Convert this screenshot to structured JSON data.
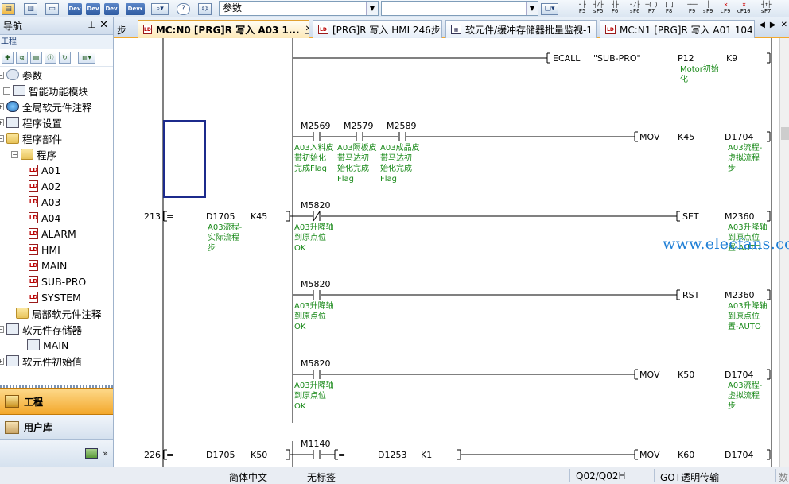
{
  "toolbar": {
    "combo_value": "参数",
    "fkeys": [
      {
        "glyph": "┤├",
        "label": "F5"
      },
      {
        "glyph": "┤/├",
        "label": "sF5"
      },
      {
        "glyph": "┤├",
        "label": "F6"
      },
      {
        "glyph": "┤/├",
        "label": "sF6"
      },
      {
        "glyph": "─( )",
        "label": "F7"
      },
      {
        "glyph": "[  ]",
        "label": "F8"
      },
      {
        "glyph": "───",
        "label": "F9"
      },
      {
        "glyph": "│",
        "label": "sF9"
      },
      {
        "glyph": "✕",
        "label": "cF9"
      },
      {
        "glyph": "✕",
        "label": "cF10"
      },
      {
        "glyph": "┤↑├",
        "label": "sF7"
      }
    ]
  },
  "nav": {
    "title": "导航",
    "subtitle": "工程",
    "tree": [
      {
        "label": "参数",
        "icon": "gear-icon"
      },
      {
        "label": "智能功能模块",
        "icon": "module-icon"
      },
      {
        "label": "全局软元件注释",
        "icon": "globe-icon"
      },
      {
        "label": "程序设置",
        "icon": "settings-icon"
      },
      {
        "label": "程序部件",
        "icon": "folder-icon"
      },
      {
        "label": "程序",
        "icon": "folder-icon"
      },
      {
        "label": "A01",
        "icon": "program-icon"
      },
      {
        "label": "A02",
        "icon": "program-icon"
      },
      {
        "label": "A03",
        "icon": "program-icon"
      },
      {
        "label": "A04",
        "icon": "program-icon"
      },
      {
        "label": "ALARM",
        "icon": "program-icon"
      },
      {
        "label": "HMI",
        "icon": "program-icon"
      },
      {
        "label": "MAIN",
        "icon": "program-icon"
      },
      {
        "label": "SUB-PRO",
        "icon": "program-icon"
      },
      {
        "label": "SYSTEM",
        "icon": "program-icon"
      },
      {
        "label": "局部软元件注释",
        "icon": "folder-icon"
      },
      {
        "label": "软元件存储器",
        "icon": "memory-icon"
      },
      {
        "label": "MAIN",
        "icon": "memory-icon"
      },
      {
        "label": "软元件初始值",
        "icon": "memory-icon"
      }
    ],
    "bottom_project": "工程",
    "bottom_library": "用户库"
  },
  "tabs": [
    {
      "label": "MC:N0 [PRG]R 写入 A03 1...",
      "active": true
    },
    {
      "label": "[PRG]R 写入 HMI 246步",
      "active": false
    },
    {
      "label": "软元件/缓冲存储器批量监视-1",
      "active": false
    },
    {
      "label": "MC:N1 [PRG]R 写入 A01 104",
      "active": false
    }
  ],
  "tab_left_partial": "步",
  "ladder": {
    "top": {
      "instr": "ECALL",
      "arg1": "\"SUB-PRO\"",
      "arg2": "P12",
      "arg3": "K9",
      "comment": [
        "Motor初始",
        "化"
      ]
    },
    "rung1": {
      "contacts": [
        {
          "dev": "M2569",
          "comment": [
            "A03入料皮",
            "带初始化",
            "完成Flag"
          ]
        },
        {
          "dev": "M2579",
          "comment": [
            "A03隔板皮",
            "带马达初",
            "始化完成",
            "Flag"
          ]
        },
        {
          "dev": "M2589",
          "comment": [
            "A03成品皮",
            "带马达初",
            "始化完成",
            "Flag"
          ]
        }
      ],
      "instr": "MOV",
      "arg1": "K45",
      "arg2": "D1704",
      "arg2_comment": [
        "A03流程-",
        "虚拟流程",
        "步"
      ]
    },
    "step213": "213",
    "rung213": {
      "compare": "=",
      "dev": "D1705",
      "k": "K45",
      "dev_comment": [
        "A03流程-",
        "实际流程",
        "步"
      ],
      "contact": {
        "dev": "M5820",
        "comment": [
          "A03升降轴",
          "到原点位",
          "OK"
        ]
      },
      "instr": "SET",
      "out": "M2360",
      "out_comment": [
        "A03升降轴",
        "到原点位",
        "置-AUTO"
      ]
    },
    "rung_rst": {
      "dev": "M5820",
      "comment": [
        "A03升降轴",
        "到原点位",
        "OK"
      ],
      "instr": "RST",
      "out": "M2360",
      "out_comment": [
        "A03升降轴",
        "到原点位",
        "置-AUTO"
      ]
    },
    "rung_mov50": {
      "dev": "M5820",
      "comment": [
        "A03升降轴",
        "到原点位",
        "OK"
      ],
      "instr": "MOV",
      "arg1": "K50",
      "arg2": "D1704",
      "arg2_comment": [
        "A03流程-",
        "虚拟流程",
        "步"
      ]
    },
    "step226": "226",
    "rung226": {
      "compare": "=",
      "dev": "D1705",
      "k": "K50",
      "contact": "M1140",
      "compare2": "=",
      "dev2": "D1253",
      "k2": "K1",
      "instr": "MOV",
      "arg1": "K60",
      "arg2": "D1704"
    }
  },
  "status": {
    "lang": "简体中文",
    "title": "无标签",
    "cpu": "Q02/Q02H",
    "conn": "GOT透明传输",
    "extra": "数"
  },
  "watermark": "www.elecfans.com"
}
